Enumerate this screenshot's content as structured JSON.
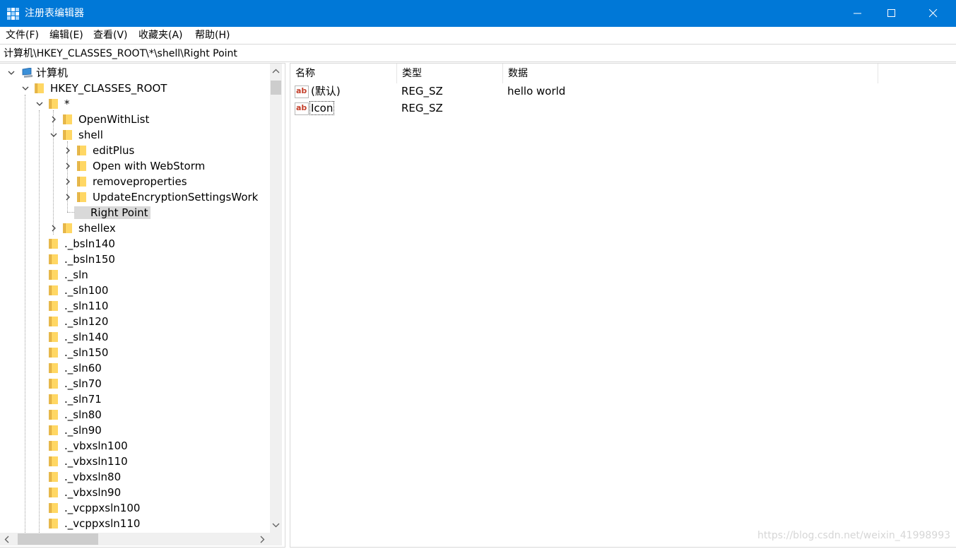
{
  "window": {
    "title": "注册表编辑器",
    "icon": "regedit-icon",
    "buttons": {
      "minimize": "minimize-icon",
      "maximize": "maximize-icon",
      "close": "close-icon"
    }
  },
  "menu": {
    "items": [
      {
        "label": "文件(F)"
      },
      {
        "label": "编辑(E)"
      },
      {
        "label": "查看(V)"
      },
      {
        "label": "收藏夹(A)"
      },
      {
        "label": "帮助(H)"
      }
    ]
  },
  "address": {
    "path": "计算机\\HKEY_CLASSES_ROOT\\*\\shell\\Right Point"
  },
  "tree": {
    "items": [
      {
        "label": "计算机",
        "icon": "computer-icon",
        "expanded": true
      },
      {
        "label": "HKEY_CLASSES_ROOT",
        "icon": "folder-icon",
        "expanded": true
      },
      {
        "label": "*",
        "icon": "folder-icon",
        "expanded": true
      },
      {
        "label": "OpenWithList",
        "icon": "folder-icon",
        "expanded": false
      },
      {
        "label": "shell",
        "icon": "folder-icon",
        "expanded": true
      },
      {
        "label": "editPlus",
        "icon": "folder-icon",
        "expanded": false
      },
      {
        "label": "Open with WebStorm",
        "icon": "folder-icon",
        "expanded": false
      },
      {
        "label": "removeproperties",
        "icon": "folder-icon",
        "expanded": false
      },
      {
        "label": "UpdateEncryptionSettingsWork",
        "icon": "folder-icon",
        "expanded": false
      },
      {
        "label": "Right Point",
        "icon": "folder-icon",
        "selected": true
      },
      {
        "label": "shellex",
        "icon": "folder-icon",
        "expanded": false
      },
      {
        "label": "._bsln140",
        "icon": "folder-icon"
      },
      {
        "label": "._bsln150",
        "icon": "folder-icon"
      },
      {
        "label": "._sln",
        "icon": "folder-icon"
      },
      {
        "label": "._sln100",
        "icon": "folder-icon"
      },
      {
        "label": "._sln110",
        "icon": "folder-icon"
      },
      {
        "label": "._sln120",
        "icon": "folder-icon"
      },
      {
        "label": "._sln140",
        "icon": "folder-icon"
      },
      {
        "label": "._sln150",
        "icon": "folder-icon"
      },
      {
        "label": "._sln60",
        "icon": "folder-icon"
      },
      {
        "label": "._sln70",
        "icon": "folder-icon"
      },
      {
        "label": "._sln71",
        "icon": "folder-icon"
      },
      {
        "label": "._sln80",
        "icon": "folder-icon"
      },
      {
        "label": "._sln90",
        "icon": "folder-icon"
      },
      {
        "label": "._vbxsln100",
        "icon": "folder-icon"
      },
      {
        "label": "._vbxsln110",
        "icon": "folder-icon"
      },
      {
        "label": "._vbxsln80",
        "icon": "folder-icon"
      },
      {
        "label": "._vbxsln90",
        "icon": "folder-icon"
      },
      {
        "label": "._vcppxsln100",
        "icon": "folder-icon"
      },
      {
        "label": "._vcppxsln110",
        "icon": "folder-icon"
      }
    ]
  },
  "values": {
    "columns": [
      "名称",
      "类型",
      "数据"
    ],
    "rows": [
      {
        "name": "(默认)",
        "type": "REG_SZ",
        "data": "hello world",
        "icon": "ab"
      },
      {
        "name": "Icon",
        "type": "REG_SZ",
        "data": "",
        "icon": "ab"
      }
    ]
  },
  "watermark": "https://blog.csdn.net/weixin_41998993",
  "colors": {
    "titlebar": "#0078d7",
    "selection": "#d9d9d9",
    "folder": "#ffd764",
    "string_icon": "#c4402b"
  }
}
